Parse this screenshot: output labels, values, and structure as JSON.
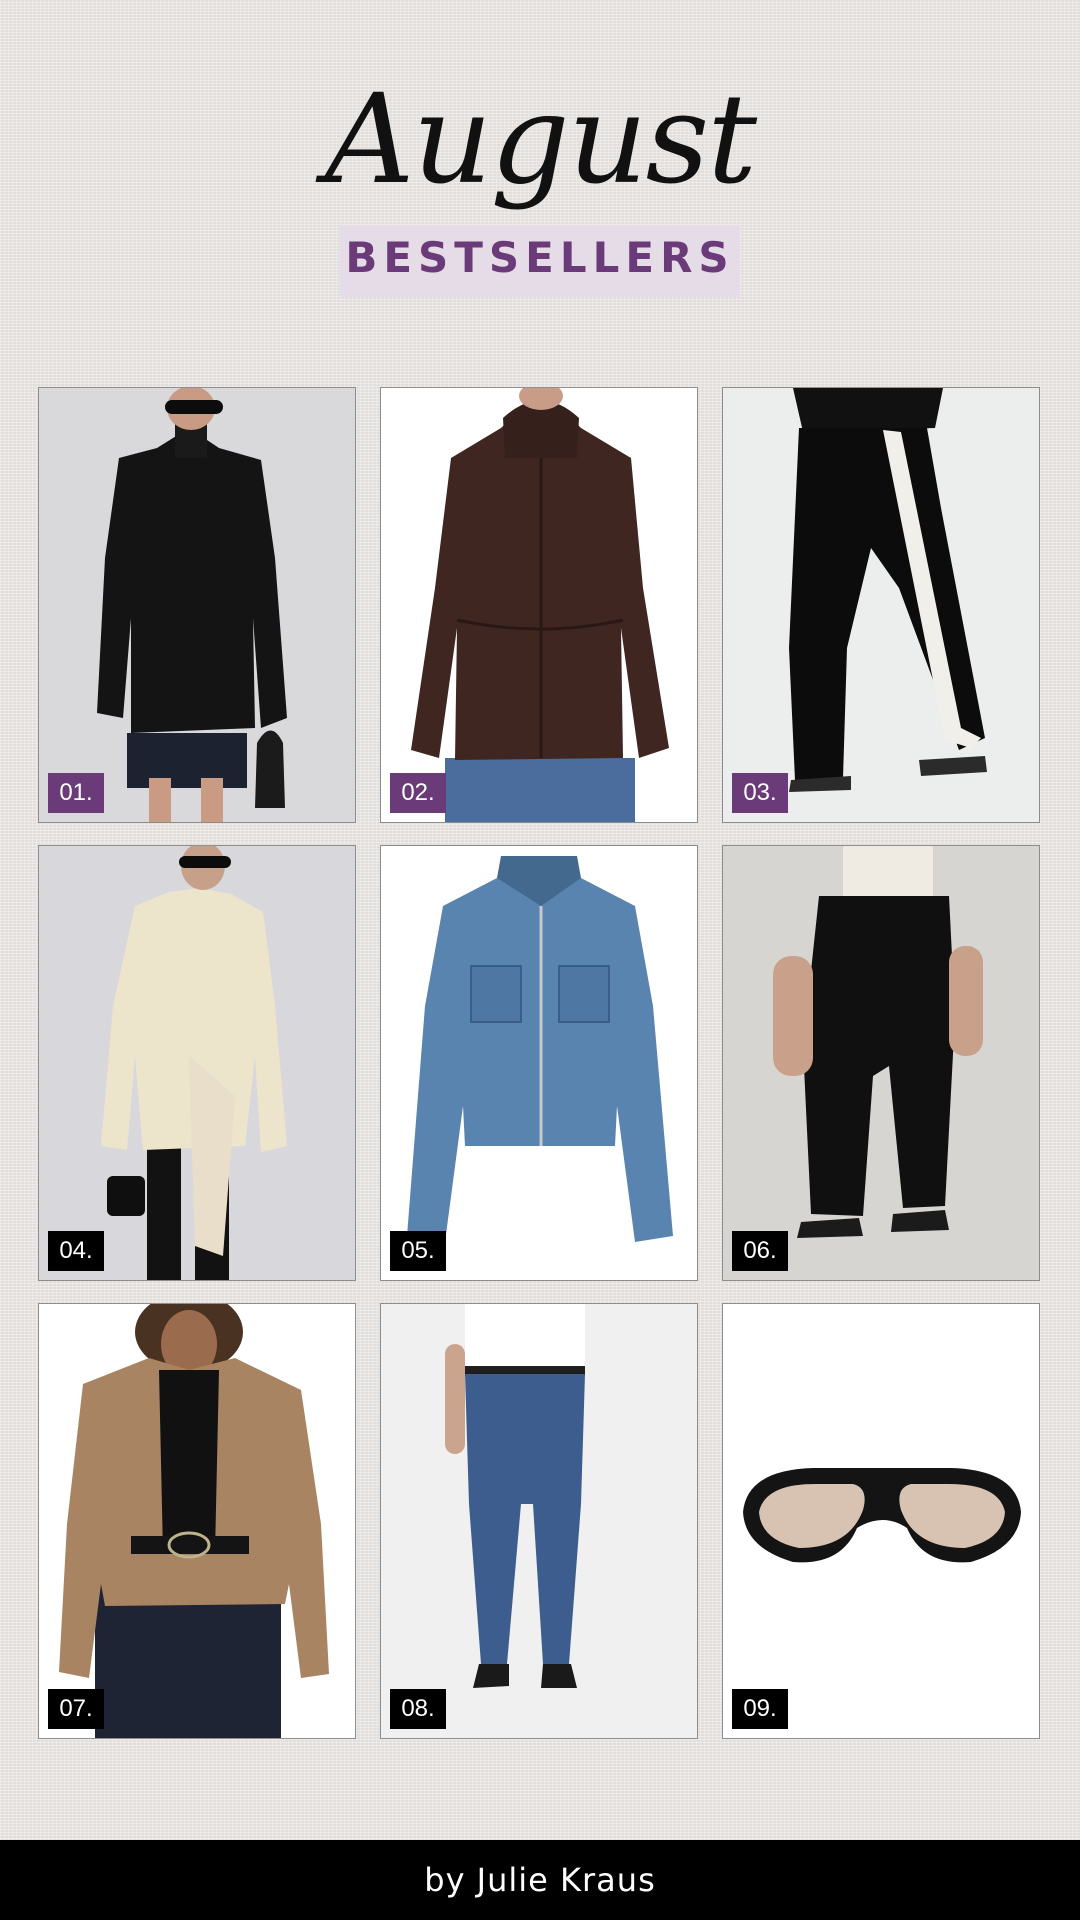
{
  "header": {
    "script_title": "August",
    "subtitle": "BESTSELLERS"
  },
  "colors": {
    "background": "#ebe8e6",
    "accent_purple": "#6b3a78",
    "subtitle_band": "#e6dce8",
    "badge_black": "#000000",
    "footer_bg": "#000000"
  },
  "products": [
    {
      "number": "01.",
      "item": "black leather jacket",
      "badge_color": "#6b3a78"
    },
    {
      "number": "02.",
      "item": "brown hooded parka",
      "badge_color": "#6b3a78"
    },
    {
      "number": "03.",
      "item": "black side-stripe trousers",
      "badge_color": "#6b3a78"
    },
    {
      "number": "04.",
      "item": "cream double-breasted blazer",
      "badge_color": "#000000"
    },
    {
      "number": "05.",
      "item": "denim zip jacket",
      "badge_color": "#000000"
    },
    {
      "number": "06.",
      "item": "black pleated barrel trousers",
      "badge_color": "#000000"
    },
    {
      "number": "07.",
      "item": "tan suede bomber jacket",
      "badge_color": "#000000"
    },
    {
      "number": "08.",
      "item": "straight-leg blue jeans",
      "badge_color": "#000000"
    },
    {
      "number": "09.",
      "item": "black shield sunglasses",
      "badge_color": "#000000"
    }
  ],
  "footer": {
    "credit": "by Julie Kraus"
  }
}
